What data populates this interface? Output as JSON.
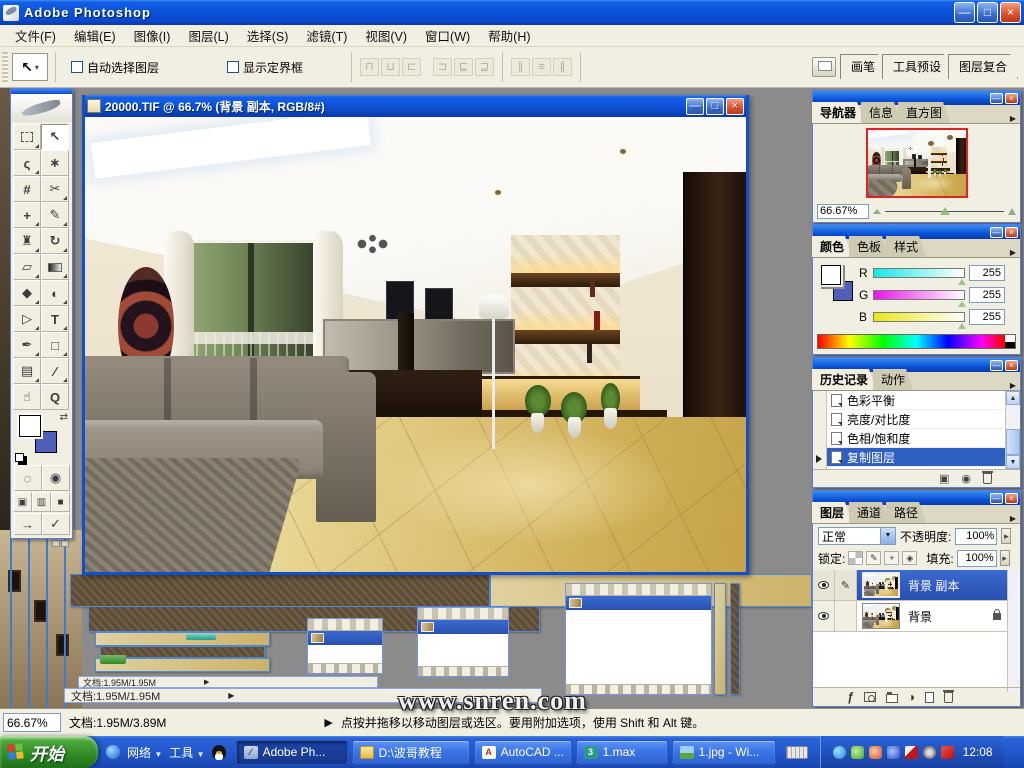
{
  "titlebar": {
    "title": "Adobe Photoshop"
  },
  "menus": {
    "items": [
      "文件(F)",
      "编辑(E)",
      "图像(I)",
      "图层(L)",
      "选择(S)",
      "滤镜(T)",
      "视图(V)",
      "窗口(W)",
      "帮助(H)"
    ]
  },
  "options": {
    "auto_select": "自动选择图层",
    "show_bbox": "显示定界框",
    "well_tabs": [
      "画笔",
      "工具预设",
      "图层复合"
    ],
    "align_icons": [
      "⊓",
      "⊔",
      "⊏",
      "⊐",
      "⊑",
      "⊒",
      "∥",
      "≡",
      "∦"
    ]
  },
  "document": {
    "title": "20000.TIF @ 66.7% (背景 副本, RGB/8#)"
  },
  "toolbox": {
    "icons": {
      "move": "↖",
      "lasso": "ς",
      "wand": "∗",
      "crop": "#",
      "slice": "✂",
      "healing": "+",
      "brush": "✎",
      "stamp": "♜",
      "history_brush": "↻",
      "eraser": "▱",
      "blur": "◆",
      "dodge": "◐",
      "path_select": "▷",
      "type": "T",
      "pen": "✒",
      "shape": "□",
      "notes": "▤",
      "eyedropper": "∕",
      "hand": "☝",
      "zoom": "Q",
      "standard_mode": "◌",
      "quick_mask": "◉",
      "screen_std": "▣",
      "screen_menu": "▥",
      "screen_full": "■",
      "jump_arrow": "→",
      "jump_check": "✓",
      "swap": "⇄"
    }
  },
  "navigator": {
    "tabs": [
      "导航器",
      "信息",
      "直方图"
    ],
    "zoom": "66.67%"
  },
  "color_panel": {
    "tabs": [
      "颜色",
      "色板",
      "样式"
    ],
    "rows": [
      {
        "ch": "R",
        "val": "255"
      },
      {
        "ch": "G",
        "val": "255"
      },
      {
        "ch": "B",
        "val": "255"
      }
    ]
  },
  "history": {
    "tabs": [
      "历史记录",
      "动作"
    ],
    "items": [
      "色彩平衡",
      "亮度/对比度",
      "色相/饱和度",
      "复制图层"
    ]
  },
  "layers_panel": {
    "tabs": [
      "图层",
      "通道",
      "路径"
    ],
    "blend_mode": "正常",
    "opacity_label": "不透明度:",
    "opacity": "100%",
    "lock_label": "锁定:",
    "fill_label": "填充:",
    "fill": "100%",
    "rows": [
      {
        "name": "背景 副本"
      },
      {
        "name": "背景"
      }
    ]
  },
  "statusbar": {
    "zoom": "66.67%",
    "doc": "文档:1.95M/3.89M",
    "hint": "点按并拖移以移动图层或选区。要用附加选项，使用 Shift 和 Alt 键。"
  },
  "cascade": {
    "doc_small": "文档:1.95M/1.95M",
    "watermark": "www.snren.com"
  },
  "taskbar": {
    "start": "开始",
    "quick": [
      {
        "label": "网络"
      },
      {
        "label": "工具"
      }
    ],
    "tasks": [
      {
        "label": "Adobe Ph..."
      },
      {
        "label": "D:\\波哥教程"
      },
      {
        "label": "AutoCAD ..."
      },
      {
        "label": "1.max"
      },
      {
        "label": "1.jpg - Wi..."
      }
    ],
    "clock": "12:08"
  },
  "glyphs": {
    "min": "—",
    "max": "□",
    "close": "×",
    "down": "▼",
    "flyout": "▶",
    "spin": "▸",
    "pointer": "▶",
    "dropdown": "▾",
    "up": "▲"
  },
  "colors": {
    "titlebar_blue": "#0c52d8",
    "selection_blue": "#2f5fc0",
    "taskbar_green": "#2f8a26",
    "bg_swatch": "#4f5eb8",
    "nav_border_red": "#e02424"
  }
}
